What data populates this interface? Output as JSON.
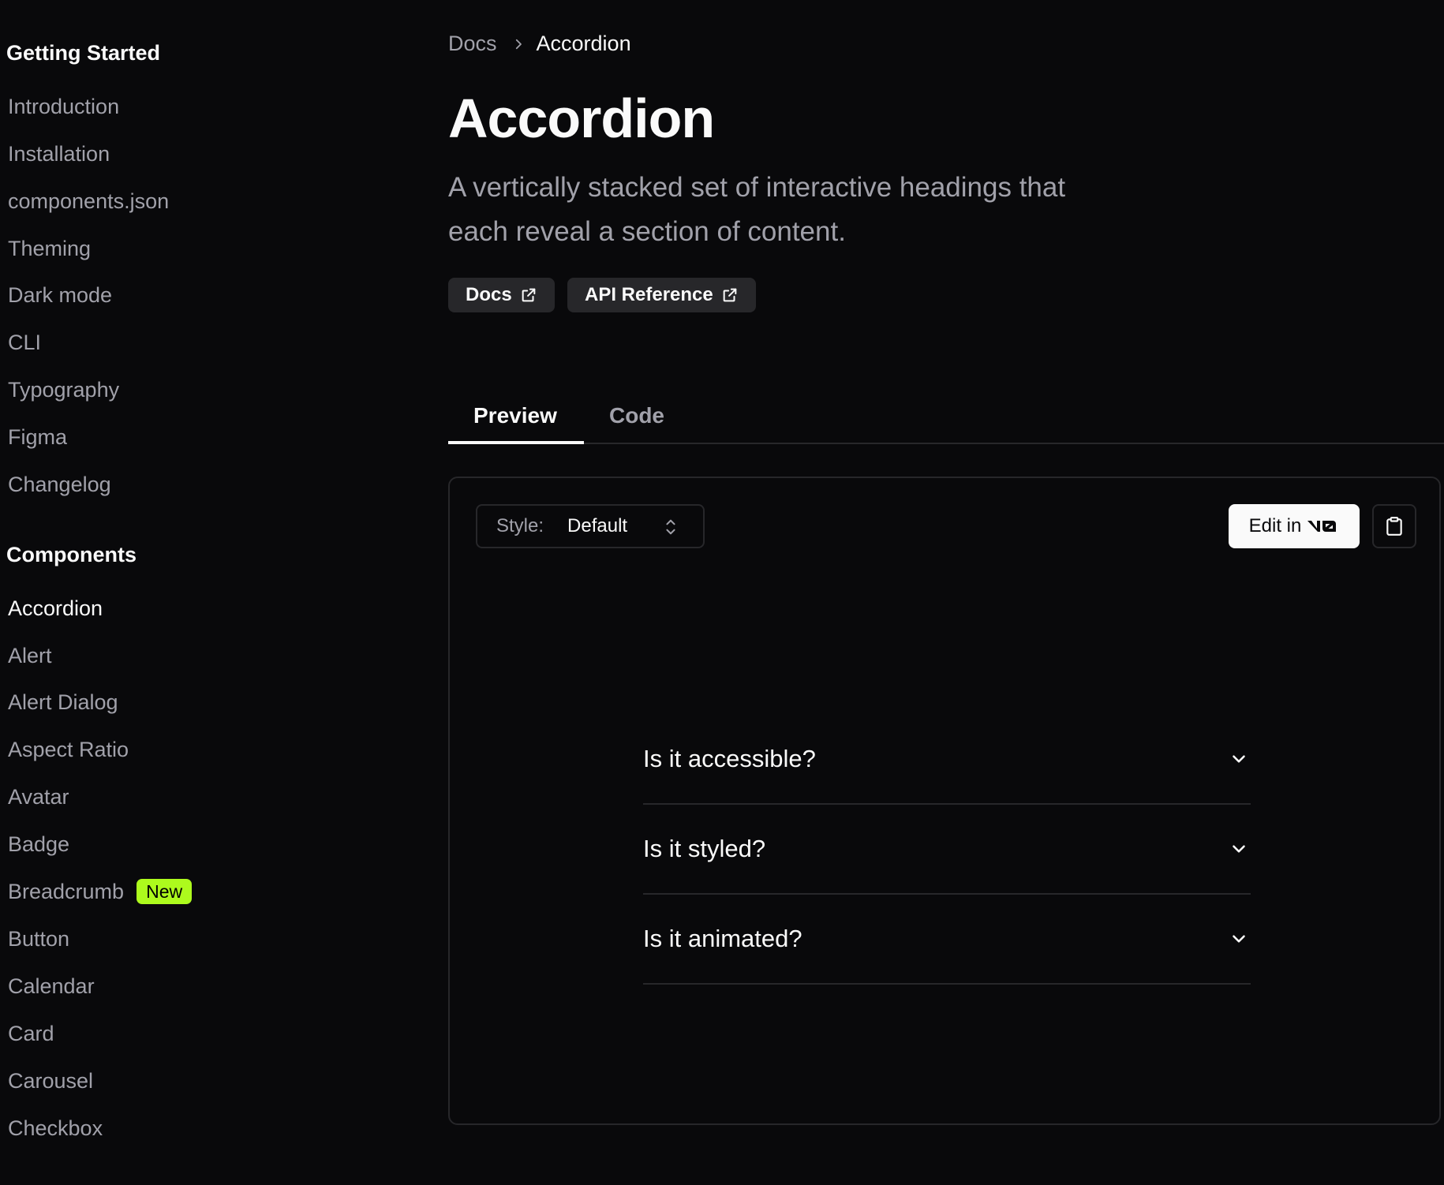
{
  "sidebar": {
    "getting_started": {
      "title": "Getting Started",
      "items": [
        {
          "label": "Introduction"
        },
        {
          "label": "Installation"
        },
        {
          "label": "components.json"
        },
        {
          "label": "Theming"
        },
        {
          "label": "Dark mode"
        },
        {
          "label": "CLI"
        },
        {
          "label": "Typography"
        },
        {
          "label": "Figma"
        },
        {
          "label": "Changelog"
        }
      ]
    },
    "components": {
      "title": "Components",
      "items": [
        {
          "label": "Accordion",
          "active": true
        },
        {
          "label": "Alert"
        },
        {
          "label": "Alert Dialog"
        },
        {
          "label": "Aspect Ratio"
        },
        {
          "label": "Avatar"
        },
        {
          "label": "Badge"
        },
        {
          "label": "Breadcrumb",
          "badge": "New"
        },
        {
          "label": "Button"
        },
        {
          "label": "Calendar"
        },
        {
          "label": "Card"
        },
        {
          "label": "Carousel"
        },
        {
          "label": "Checkbox"
        }
      ]
    }
  },
  "breadcrumb": {
    "root": "Docs",
    "current": "Accordion"
  },
  "page": {
    "title": "Accordion",
    "description": "A vertically stacked set of interactive headings that each reveal a section of content.",
    "links": [
      {
        "label": "Docs",
        "icon": "external-link-icon"
      },
      {
        "label": "API Reference",
        "icon": "external-link-icon"
      }
    ]
  },
  "tabs": [
    {
      "label": "Preview",
      "active": true
    },
    {
      "label": "Code"
    }
  ],
  "preview": {
    "style_label": "Style:",
    "style_value": "Default",
    "edit_label": "Edit in",
    "edit_icon": "v0-logo-icon",
    "copy_icon": "clipboard-icon",
    "accordion": [
      {
        "question": "Is it accessible?"
      },
      {
        "question": "Is it styled?"
      },
      {
        "question": "Is it animated?"
      }
    ]
  },
  "colors": {
    "background": "#09090b",
    "foreground": "#fafafa",
    "muted": "#a1a1aa",
    "border": "#27272a",
    "badge": "#adfa1d"
  }
}
